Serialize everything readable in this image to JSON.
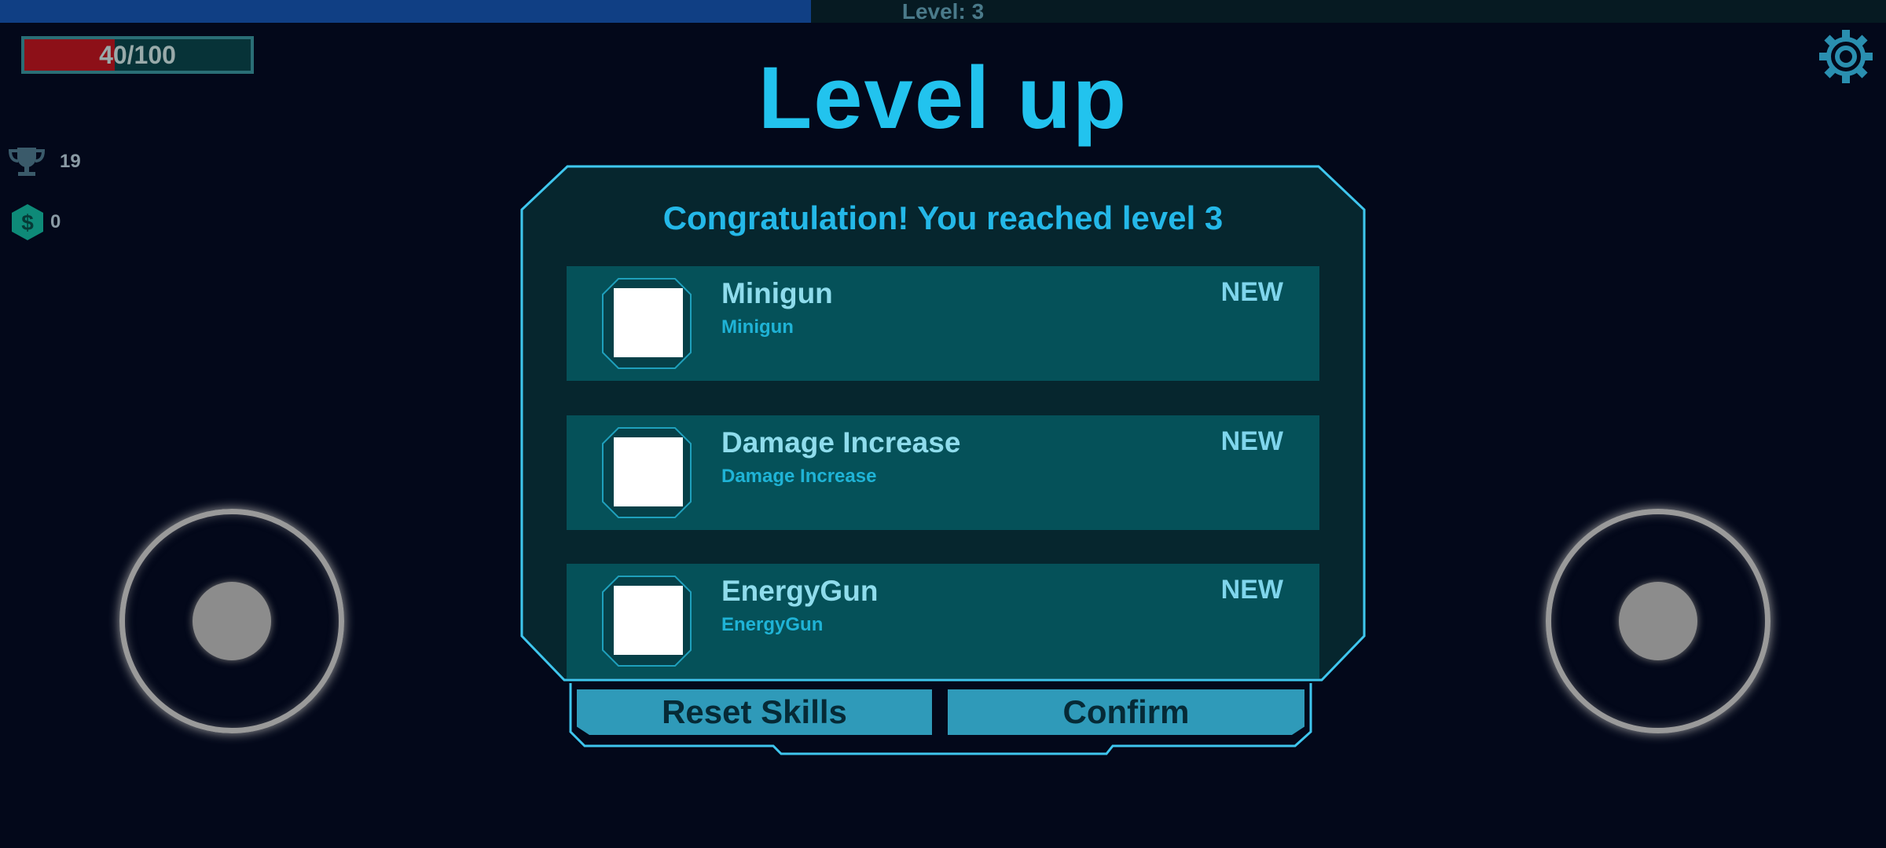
{
  "hud": {
    "level_label": "Level: 3",
    "xp_progress": 0.43,
    "hp_text": "40/100",
    "hp_fraction": 0.4,
    "trophies": "19",
    "coins": "0"
  },
  "dialog": {
    "title": "Level up",
    "subtitle": "Congratulation! You reached level 3",
    "skills": [
      {
        "name": "Minigun",
        "description": "Minigun",
        "badge": "NEW"
      },
      {
        "name": "Damage Increase",
        "description": "Damage Increase",
        "badge": "NEW"
      },
      {
        "name": "EnergyGun",
        "description": "EnergyGun",
        "badge": "NEW"
      }
    ],
    "reset_label": "Reset Skills",
    "confirm_label": "Confirm"
  },
  "colors": {
    "accent": "#22c3ee",
    "panel": "#06262e",
    "card": "#055159",
    "button": "#2f9ab9",
    "hp": "#8d1018",
    "xp": "#103f84"
  },
  "icons": [
    "settings-gear-icon",
    "trophy-icon",
    "coin-icon"
  ]
}
